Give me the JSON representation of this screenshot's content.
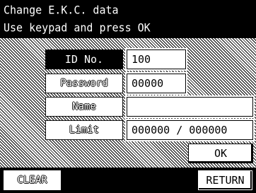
{
  "header": {
    "title": "Change E.K.C. data",
    "instruction": "Use keypad and press OK"
  },
  "form": {
    "id_label": "ID No.",
    "id_value": "100",
    "password_label": "Password",
    "password_value": "00000",
    "name_label": "Name",
    "name_value": "",
    "limit_label": "Limit",
    "limit_value": "000000 / 000000"
  },
  "buttons": {
    "ok": "OK",
    "clear": "CLEAR",
    "return": "RETURN"
  }
}
